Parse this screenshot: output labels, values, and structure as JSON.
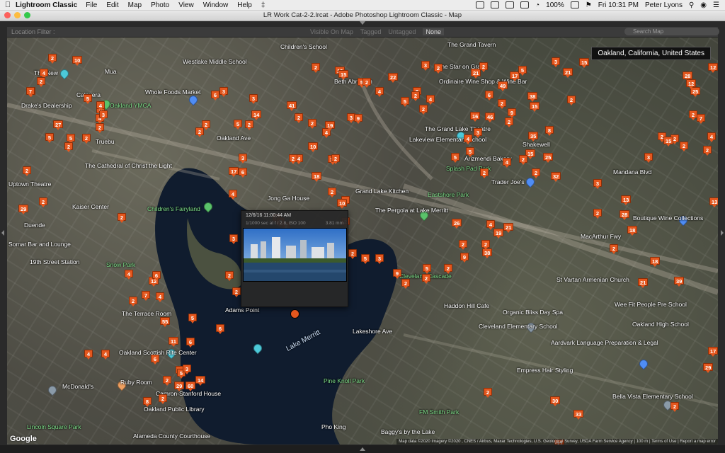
{
  "menubar": {
    "app_name": "Lightroom Classic",
    "menus": [
      "File",
      "Edit",
      "Map",
      "Photo",
      "View",
      "Window",
      "Help"
    ],
    "battery": "100%",
    "clock": "Fri 10:31 PM",
    "user": "Peter Lyons"
  },
  "window": {
    "title": "LR Work Cat-2-2.lrcat - Adobe Photoshop Lightroom Classic - Map"
  },
  "filterbar": {
    "label": "Location Filter :",
    "options": [
      "Visible On Map",
      "Tagged",
      "Untagged",
      "None"
    ],
    "active": "None",
    "search_placeholder": "Search Map"
  },
  "map": {
    "location_label": "Oakland, California, United States",
    "google_logo": "Google",
    "attribution": "Map data ©2020 Imagery ©2020 , CNES / Airbus, Maxar Technologies, U.S. Geological Survey, USDA Farm Service Agency | 100 m | Terms of Use | Report a map error",
    "lake_label": "Lake Merritt",
    "labels": {
      "l1": "Westlake Middle School",
      "l2": "Whole Foods Market",
      "l3": "Oakland YMCA",
      "l4": "Drake's Dealership",
      "l5": "Calavera",
      "l6": "The Cathedral of Christ the Light",
      "l7": "Kaiser Center",
      "l8": "Children's Fairyland",
      "l9": "Snow Park",
      "l10": "19th Street Station",
      "l11": "The Terrace Room",
      "l12": "Oakland Scottish Rite Center",
      "l13": "Ruby Room",
      "l14": "Camron-Stanford House",
      "l15": "Oakland Public Library",
      "l16": "McDonald's",
      "l17": "Alameda County Courthouse",
      "l18": "The Grand Lake Theatre",
      "l19": "Lakeview Elementary School",
      "l20": "Arizmendi Bakery",
      "l21": "Trader Joe's",
      "l22": "Splash Pad Park",
      "l23": "Grand Lake Kitchen",
      "l24": "The Pergola at Lake Merritt",
      "l25": "Eastshore Park",
      "l26": "Jong Ga House",
      "l27": "Cleveland Cascade",
      "l28": "Haddon Hill Cafe",
      "l29": "Cleveland Elementary School",
      "l30": "Organic Bliss Day Spa",
      "l31": "St Vartan Armenian Church",
      "l32": "Wee Fit People Pre School",
      "l33": "Oakland High School",
      "l34": "Aardvark Language Preparation & Legal",
      "l35": "Empress Hair Styling",
      "l36": "Bella Vista Elementary School",
      "l37": "Pine Knoll Park",
      "l38": "FM Smith Park",
      "l39": "Baggy's by the Lake",
      "l40": "Pho King",
      "l41": "Lakeshore Ave",
      "l42": "Boutique Wine Collections",
      "l43": "Mandana Blvd",
      "l44": "MacArthur Fwy",
      "l45": "The Star on Grand",
      "l46": "Ordinaire Wine Shop & Wine Bar",
      "l47": "The Grand Tavern",
      "l48": "Shakewell",
      "l49": "Somar Bar and Lounge",
      "l50": "Lincoln Square Park",
      "l51": "Lake Merritt",
      "l52": "Adams Point",
      "l53": "Beth Abraham",
      "l54": "Children's School",
      "l55": "Truebu",
      "l56": "The New",
      "l57": "Duende",
      "l58": "Uptown Theatre",
      "l59": "Oakland Ave",
      "l60": "Mua"
    }
  },
  "popup": {
    "datetime": "12/6/16 11:00:44 AM",
    "exposure": "1/1000 sec at f / 2.8, ISO 100",
    "focal": "3.81 mm"
  },
  "pins": [
    "7",
    "10",
    "2",
    "6",
    "4",
    "2",
    "5",
    "7",
    "6",
    "4",
    "27",
    "2",
    "5",
    "5",
    "2",
    "2",
    "4",
    "3",
    "29",
    "2",
    "2",
    "2",
    "4",
    "12",
    "2",
    "7",
    "4",
    "6",
    "6",
    "11",
    "4",
    "4",
    "6",
    "5",
    "3",
    "14",
    "2",
    "29",
    "60",
    "8",
    "2",
    "6",
    "5",
    "6",
    "55",
    "17",
    "2",
    "5",
    "2",
    "3",
    "14",
    "41",
    "3",
    "2",
    "10",
    "15",
    "4",
    "4",
    "2",
    "2",
    "2",
    "13",
    "15",
    "19",
    "3",
    "9",
    "22",
    "2",
    "5",
    "4",
    "2",
    "3",
    "2",
    "5",
    "8",
    "2",
    "4",
    "2",
    "21",
    "6",
    "49",
    "38",
    "2",
    "16",
    "15",
    "46",
    "2",
    "35",
    "8",
    "3",
    "5",
    "9",
    "2",
    "17",
    "25",
    "15",
    "2",
    "15",
    "21",
    "3",
    "5",
    "5",
    "4",
    "2",
    "4",
    "2",
    "2",
    "32",
    "3",
    "13",
    "3",
    "2",
    "2",
    "15",
    "2",
    "12",
    "25",
    "28",
    "2",
    "7",
    "4",
    "2",
    "13",
    "12",
    "18",
    "28",
    "2",
    "2",
    "21",
    "18",
    "39",
    "17",
    "29",
    "2",
    "33",
    "27",
    "30",
    "2",
    "38",
    "2",
    "19",
    "4",
    "21",
    "26",
    "2",
    "9",
    "2",
    "5",
    "2",
    "2",
    "9",
    "3",
    "5",
    "2",
    "2",
    "2",
    "7",
    "18",
    "10",
    "2",
    "3",
    "6",
    "4",
    "3",
    "2",
    "2",
    "2",
    "5",
    "7",
    "8"
  ]
}
